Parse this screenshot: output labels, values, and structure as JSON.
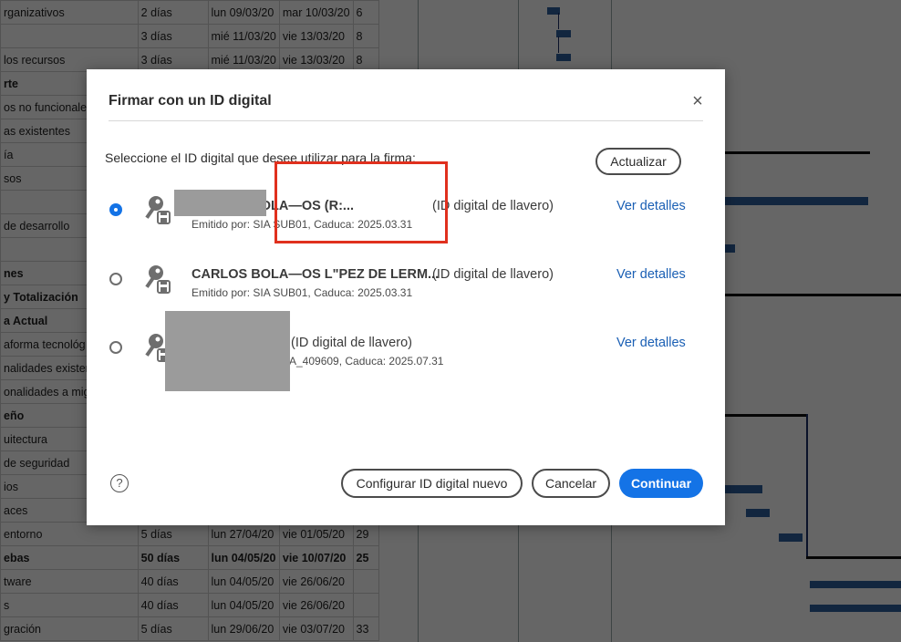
{
  "background_sheet": {
    "rows": [
      [
        "rganizativos",
        "2 días",
        "lun 09/03/20",
        "mar 10/03/20",
        "6"
      ],
      [
        "",
        "3 días",
        "mié 11/03/20",
        "vie 13/03/20",
        "8"
      ],
      [
        "los recursos",
        "3 días",
        "mié 11/03/20",
        "vie 13/03/20",
        "8"
      ],
      [
        "rte",
        "",
        "",
        "",
        ""
      ],
      [
        "os no funcionales",
        "",
        "",
        "",
        ""
      ],
      [
        "as existentes",
        "",
        "",
        "",
        ""
      ],
      [
        "ía",
        "",
        "",
        "",
        ""
      ],
      [
        "sos",
        "",
        "",
        "",
        ""
      ],
      [
        "",
        "",
        "",
        "",
        ""
      ],
      [
        "de desarrollo",
        "",
        "",
        "",
        ""
      ],
      [
        "",
        "",
        "",
        "",
        ""
      ],
      [
        "nes",
        "",
        "",
        "",
        ""
      ],
      [
        "y Totalización",
        "",
        "",
        "",
        ""
      ],
      [
        "a Actual",
        "",
        "",
        "",
        ""
      ],
      [
        "aforma tecnológ",
        "",
        "",
        "",
        ""
      ],
      [
        "nalidades existent",
        "",
        "",
        "",
        ""
      ],
      [
        "onalidades a mig",
        "",
        "",
        "",
        ""
      ],
      [
        "eño",
        "",
        "",
        "",
        ""
      ],
      [
        "uitectura",
        "",
        "",
        "",
        ""
      ],
      [
        "de seguridad",
        "",
        "",
        "",
        ""
      ],
      [
        "ios",
        "",
        "",
        "",
        ""
      ],
      [
        "aces",
        "",
        "",
        "",
        ""
      ],
      [
        "entorno",
        "5 días",
        "lun 27/04/20",
        "vie 01/05/20",
        "29"
      ],
      [
        "ebas",
        "50 días",
        "lun 04/05/20",
        "vie 10/07/20",
        "25"
      ],
      [
        "tware",
        "40 días",
        "lun 04/05/20",
        "vie 26/06/20",
        ""
      ],
      [
        "s",
        "40 días",
        "lun 04/05/20",
        "vie 26/06/20",
        ""
      ],
      [
        "gración",
        "5 días",
        "lun 29/06/20",
        "vie 03/07/20",
        "33"
      ]
    ],
    "bold_rows": [
      3,
      11,
      12,
      13,
      17,
      23
    ]
  },
  "dialog": {
    "title": "Firmar con un ID digital",
    "close_icon": "close-icon",
    "instruction": "Seleccione el ID digital que desee utilizar para la firma:",
    "refresh_label": "Actualizar",
    "ids": [
      {
        "name": "CARLOS BOLA—OS (R:...",
        "type": "(ID digital de llavero)",
        "issuer": "Emitido por: SIA SUB01, Caduca: 2025.03.31",
        "details_label": "Ver detalles",
        "selected": true,
        "icon": "key-icon"
      },
      {
        "name": "CARLOS BOLA—OS L\"PEZ DE LERM...",
        "type": "(ID digital de llavero)",
        "issuer": "Emitido por: SIA SUB01, Caduca: 2025.03.31",
        "details_label": "Ver detalles",
        "selected": false,
        "icon": "key-icon"
      },
      {
        "name": "",
        "type": "(ID digital de llavero)",
        "issuer": "A_409609, Caduca: 2025.07.31",
        "details_label": "Ver detalles",
        "selected": false,
        "icon": "key-icon"
      }
    ],
    "help_glyph": "?",
    "configure_label": "Configurar ID digital nuevo",
    "cancel_label": "Cancelar",
    "continue_label": "Continuar"
  },
  "colors": {
    "accent": "#1473e6",
    "link": "#1a5fb4",
    "highlight": "#e0301e",
    "redaction": "#9b9b9b"
  }
}
